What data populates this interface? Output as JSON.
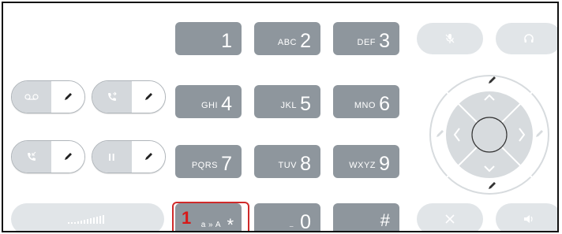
{
  "keypad": [
    {
      "digit": "1",
      "letters": ""
    },
    {
      "digit": "2",
      "letters": "ABC"
    },
    {
      "digit": "3",
      "letters": "DEF"
    },
    {
      "digit": "4",
      "letters": "GHI"
    },
    {
      "digit": "5",
      "letters": "JKL"
    },
    {
      "digit": "6",
      "letters": "MNO"
    },
    {
      "digit": "7",
      "letters": "PQRS"
    },
    {
      "digit": "8",
      "letters": "TUV"
    },
    {
      "digit": "9",
      "letters": "WXYZ"
    }
  ],
  "star_key": {
    "badge": "1",
    "letters": "a » A",
    "symbol": "*"
  },
  "zero_key": {
    "digit": "0",
    "letters": "_"
  },
  "hash_key": {
    "symbol": "#"
  },
  "top_buttons": {
    "mute_icon": "mic-off-icon",
    "headset_icon": "headset-icon"
  },
  "bottom_buttons": {
    "end_icon": "close-icon",
    "speaker_icon": "speaker-icon"
  },
  "line_keys": [
    {
      "icon": "voicemail-icon"
    },
    {
      "icon": "phone-forward-icon"
    },
    {
      "icon": "phone-transfer-icon"
    },
    {
      "icon": "pause-icon",
      "label": "II"
    }
  ],
  "volume_bar": {
    "icon": "volume-level-icon"
  },
  "accent_color": "#cf2a2a"
}
